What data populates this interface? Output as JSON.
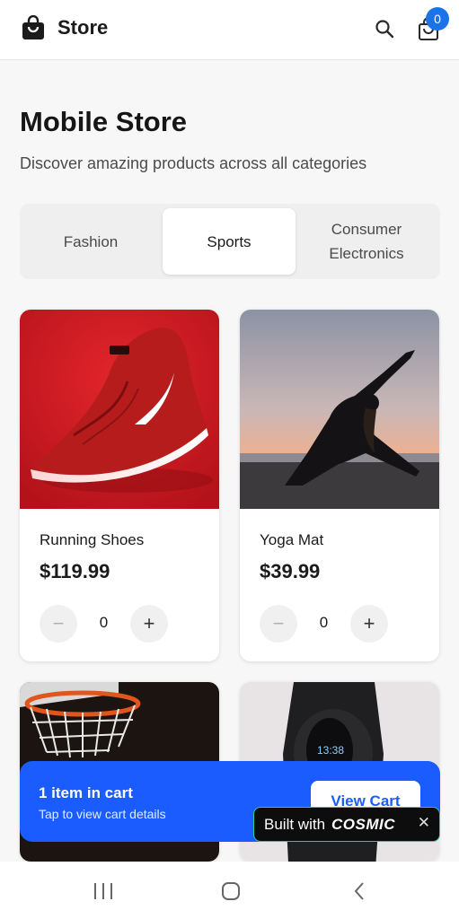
{
  "app": {
    "title": "Store",
    "cart_count": "0"
  },
  "header": {
    "title": "Mobile Store",
    "subtitle": "Discover amazing products across all categories"
  },
  "tabs": [
    {
      "label": "Fashion",
      "active": false
    },
    {
      "label": "Sports",
      "active": true
    },
    {
      "label": "Consumer Electronics",
      "active": false
    }
  ],
  "products": [
    {
      "name": "Running Shoes",
      "price": "$119.99",
      "quantity": "0",
      "image": "red-running-shoe"
    },
    {
      "name": "Yoga Mat",
      "price": "$39.99",
      "quantity": "0",
      "image": "yoga-silhouette-sunset"
    },
    {
      "image": "basketball-hoop"
    },
    {
      "image": "fitness-tracker-band",
      "screen_text": "13:38"
    }
  ],
  "cart_bar": {
    "title": "1 item in cart",
    "subtitle": "Tap to view cart details",
    "button_label": "View Cart"
  },
  "badge": {
    "prefix": "Built with",
    "brand": "COSMIC",
    "close": "✕"
  },
  "icons": {
    "brand": "shopping-bag-icon",
    "search": "search-icon",
    "cart": "cart-bag-icon",
    "minus": "−",
    "plus": "+"
  },
  "colors": {
    "accent": "#1a5cff",
    "badge": "#1a73e8"
  }
}
